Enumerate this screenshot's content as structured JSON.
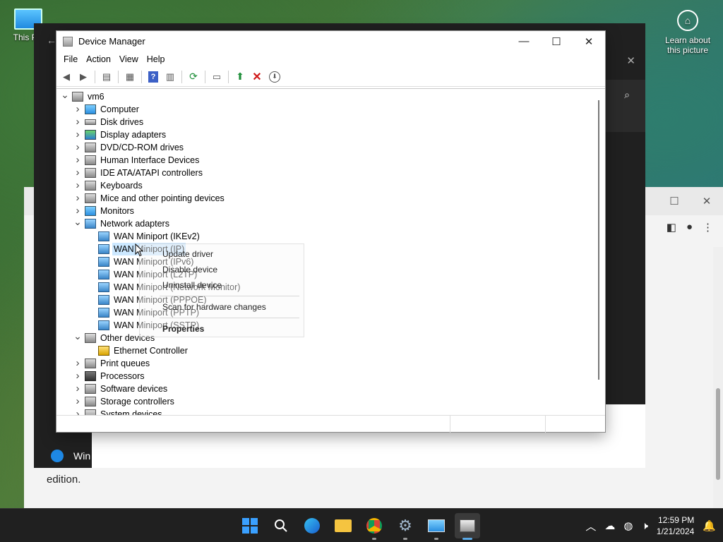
{
  "desktop": {
    "icon_label": "This PC",
    "learn_label": "Learn about this picture"
  },
  "background_window": {
    "edition_text": "edition.",
    "win_item_label": "Win"
  },
  "device_manager": {
    "title": "Device Manager",
    "menu": [
      "File",
      "Action",
      "View",
      "Help"
    ],
    "tree": [
      {
        "label": "vm6",
        "level": 0,
        "expanded": true,
        "icon": "computer-root-icon"
      },
      {
        "label": "Computer",
        "level": 1,
        "expanded": false,
        "icon": "computer-icon"
      },
      {
        "label": "Disk drives",
        "level": 1,
        "expanded": false,
        "icon": "disk-drive-icon"
      },
      {
        "label": "Display adapters",
        "level": 1,
        "expanded": false,
        "icon": "display-adapter-icon"
      },
      {
        "label": "DVD/CD-ROM drives",
        "level": 1,
        "expanded": false,
        "icon": "dvd-drive-icon"
      },
      {
        "label": "Human Interface Devices",
        "level": 1,
        "expanded": false,
        "icon": "hid-icon"
      },
      {
        "label": "IDE ATA/ATAPI controllers",
        "level": 1,
        "expanded": false,
        "icon": "ide-controller-icon"
      },
      {
        "label": "Keyboards",
        "level": 1,
        "expanded": false,
        "icon": "keyboard-icon"
      },
      {
        "label": "Mice and other pointing devices",
        "level": 1,
        "expanded": false,
        "icon": "mouse-icon"
      },
      {
        "label": "Monitors",
        "level": 1,
        "expanded": false,
        "icon": "monitor-icon"
      },
      {
        "label": "Network adapters",
        "level": 1,
        "expanded": true,
        "icon": "network-adapter-icon"
      },
      {
        "label": "WAN Miniport (IKEv2)",
        "level": 2,
        "icon": "network-adapter-icon"
      },
      {
        "label": "WAN Miniport (IP)",
        "level": 2,
        "icon": "network-adapter-icon",
        "selected": true
      },
      {
        "label": "WAN Miniport (IPv6)",
        "level": 2,
        "icon": "network-adapter-icon"
      },
      {
        "label": "WAN Miniport (L2TP)",
        "level": 2,
        "icon": "network-adapter-icon"
      },
      {
        "label": "WAN Miniport (Network Monitor)",
        "level": 2,
        "icon": "network-adapter-icon"
      },
      {
        "label": "WAN Miniport (PPPOE)",
        "level": 2,
        "icon": "network-adapter-icon"
      },
      {
        "label": "WAN Miniport (PPTP)",
        "level": 2,
        "icon": "network-adapter-icon"
      },
      {
        "label": "WAN Miniport (SSTP)",
        "level": 2,
        "icon": "network-adapter-icon"
      },
      {
        "label": "Other devices",
        "level": 1,
        "expanded": true,
        "icon": "unknown-device-icon"
      },
      {
        "label": "Ethernet Controller",
        "level": 2,
        "icon": "warning-device-icon"
      },
      {
        "label": "Print queues",
        "level": 1,
        "expanded": false,
        "icon": "printer-icon"
      },
      {
        "label": "Processors",
        "level": 1,
        "expanded": false,
        "icon": "processor-icon"
      },
      {
        "label": "Software devices",
        "level": 1,
        "expanded": false,
        "icon": "software-device-icon"
      },
      {
        "label": "Storage controllers",
        "level": 1,
        "expanded": false,
        "icon": "storage-controller-icon"
      },
      {
        "label": "System devices",
        "level": 1,
        "expanded": false,
        "icon": "system-device-icon"
      }
    ]
  },
  "context_menu": {
    "items": [
      "Update driver",
      "Disable device",
      "Uninstall device",
      "Scan for hardware changes",
      "Properties"
    ]
  },
  "taskbar": {
    "time": "12:59 PM",
    "date": "1/21/2024"
  }
}
